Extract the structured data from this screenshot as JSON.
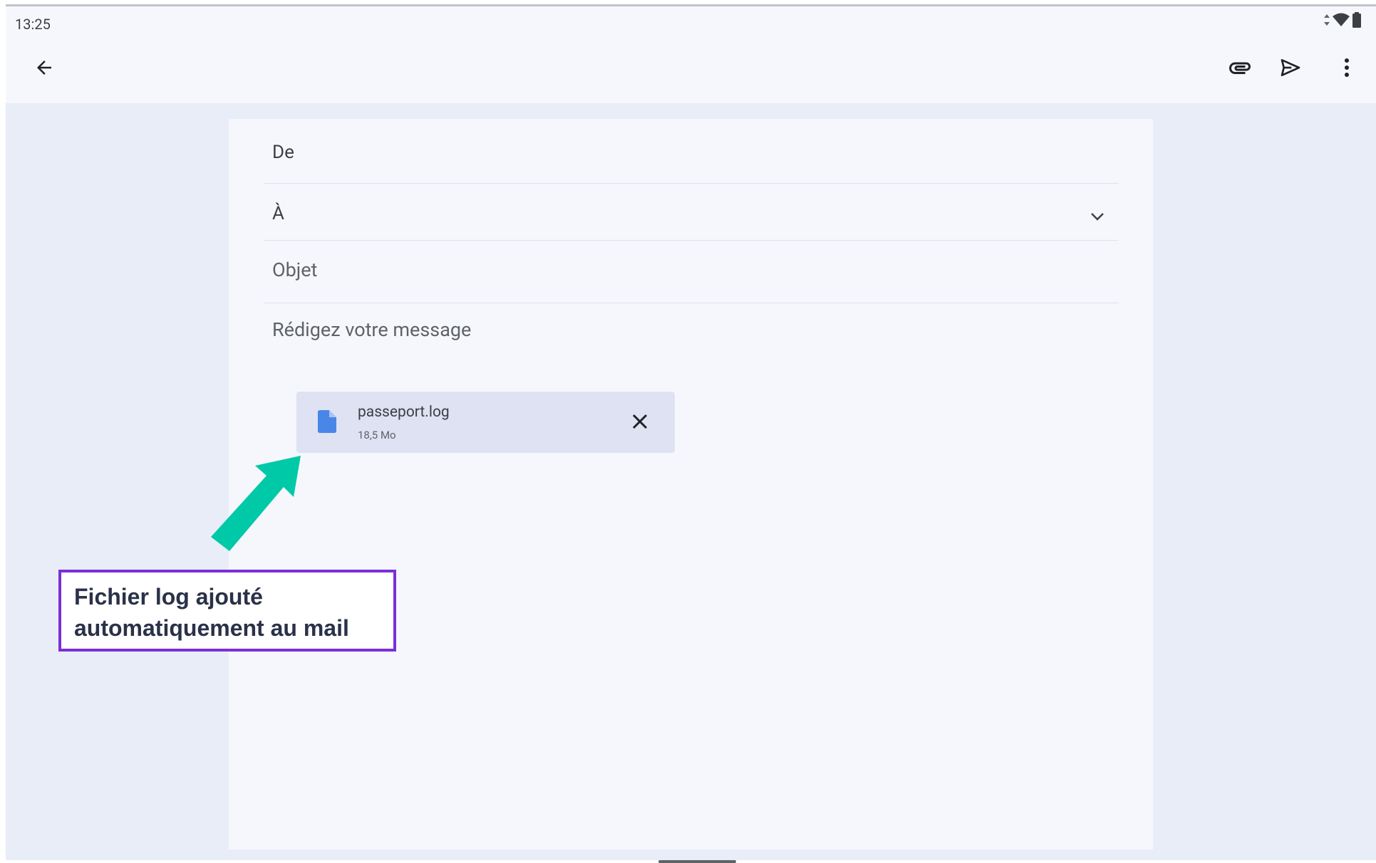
{
  "status_bar": {
    "time": "13:25",
    "icons": [
      "data-arrows-icon",
      "wifi-icon",
      "battery-icon"
    ]
  },
  "toolbar": {
    "back_icon": "arrow-back-icon",
    "attach_icon": "paperclip-icon",
    "send_icon": "send-icon",
    "more_icon": "more-vert-icon"
  },
  "compose": {
    "from_label": "De",
    "to_label": "À",
    "subject_placeholder": "Objet",
    "body_placeholder": "Rédigez votre message",
    "expand_icon": "chevron-down-icon"
  },
  "attachment": {
    "filename": "passeport.log",
    "size": "18,5 Mo",
    "file_icon": "file-icon",
    "remove_icon": "close-icon"
  },
  "annotation": {
    "line1": "Fichier log ajouté",
    "line2": "automatiquement au mail",
    "arrow_color": "#00c9a7",
    "border_color": "#7b2fd6"
  },
  "colors": {
    "accent": "#4285f4",
    "background": "#e9edf7",
    "surface": "#f6f7fd",
    "attachment_bg": "#dee2f3"
  }
}
